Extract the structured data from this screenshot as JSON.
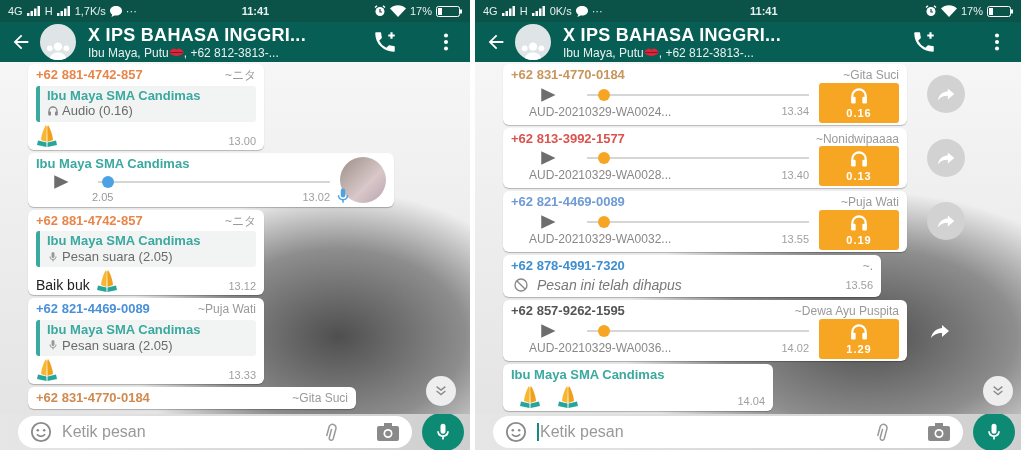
{
  "phones": [
    {
      "status_bar": {
        "network_1": "4G",
        "network_2": "H",
        "speed": "1,7K/s",
        "more": "···",
        "time": "11:41",
        "battery": "17%"
      },
      "header": {
        "title": "X IPS BAHASA INGGRI...",
        "subtitle_parts": [
          "Ibu Maya, Putu",
          ", +62 812-3813-..."
        ]
      },
      "messages": [
        {
          "kind": "reply",
          "sender": "+62 881-4742-857",
          "color": "#e8864a",
          "alias": "~ニタ",
          "quote": {
            "author": "Ibu Maya SMA Candimas",
            "kind": "audio",
            "text": "Audio (0.16)"
          },
          "emoji": [
            {
              "kind": "praying-hands"
            }
          ],
          "time": "13.00"
        },
        {
          "kind": "voice",
          "sender": "Ibu Maya SMA Candimas",
          "color": "#3aa99f",
          "level": 0.02,
          "duration": "2.05",
          "time": "13.02"
        },
        {
          "kind": "reply",
          "sender": "+62 881-4742-857",
          "color": "#e8864a",
          "alias": "~ニタ",
          "quote": {
            "author": "Ibu Maya SMA Candimas",
            "kind": "voice",
            "text": "Pesan suara (2.05)"
          },
          "text": "Baik buk",
          "emoji": [
            {
              "kind": "praying-hands"
            }
          ],
          "time": "13.12"
        },
        {
          "kind": "reply",
          "sender": "+62 821-4469-0089",
          "color": "#4a90d9",
          "alias": "~Puja Wati",
          "quote": {
            "author": "Ibu Maya SMA Candimas",
            "kind": "voice",
            "text": "Pesan suara (2.05)"
          },
          "emoji": [
            {
              "kind": "praying-hands"
            }
          ],
          "time": "13.33"
        },
        {
          "kind": "partial",
          "sender": "+62 831-4770-0184",
          "color": "#d08a4e",
          "alias": "~Gita Suci"
        }
      ],
      "input": {
        "placeholder": "Ketik pesan",
        "focused": false
      }
    },
    {
      "status_bar": {
        "network_1": "4G",
        "network_2": "H",
        "speed": "0K/s",
        "more": "···",
        "time": "11:41",
        "battery": "17%"
      },
      "header": {
        "title": "X IPS BAHASA INGGRI...",
        "subtitle_parts": [
          "Ibu Maya, Putu",
          ", +62 812-3813-..."
        ]
      },
      "messages": [
        {
          "kind": "audio",
          "sender": "+62 831-4770-0184",
          "color": "#c9955c",
          "alias": "~Gita Suci",
          "level": 0.05,
          "file": "AUD-20210329-WA0024...",
          "time": "13.34",
          "duration": "0.16",
          "forward": {
            "kind": "circle"
          }
        },
        {
          "kind": "audio",
          "sender": "+62 813-3992-1577",
          "color": "#d9534f",
          "alias": "~Nonidwipaaaa",
          "level": 0.05,
          "file": "AUD-20210329-WA0028...",
          "time": "13.40",
          "duration": "0.13",
          "forward": {
            "kind": "circle"
          }
        },
        {
          "kind": "audio",
          "sender": "+62 821-4469-0089",
          "color": "#6f9ad6",
          "alias": "~Puja Wati",
          "level": 0.05,
          "file": "AUD-20210329-WA0032...",
          "time": "13.55",
          "duration": "0.19",
          "forward": {
            "kind": "circle"
          }
        },
        {
          "kind": "deleted",
          "sender": "+62 878-4991-7320",
          "color": "#3e8ed0",
          "alias": "~.",
          "text": "Pesan ini telah dihapus",
          "time": "13.56"
        },
        {
          "kind": "audio",
          "sender": "+62 857-9262-1595",
          "color": "#555555",
          "alias": "~Dewa Ayu Puspita",
          "level": 0.05,
          "file": "AUD-20210329-WA0036...",
          "time": "14.02",
          "duration": "1.29",
          "forward": {
            "kind": "arrow"
          }
        },
        {
          "kind": "text",
          "sender": "Ibu Maya SMA Candimas",
          "color": "#3aa99f",
          "emoji": [
            {
              "kind": "praying-hands"
            },
            {
              "kind": "praying-hands"
            }
          ],
          "time": "14.04"
        }
      ],
      "input": {
        "placeholder": "Ketik pesan",
        "focused": true
      }
    }
  ]
}
